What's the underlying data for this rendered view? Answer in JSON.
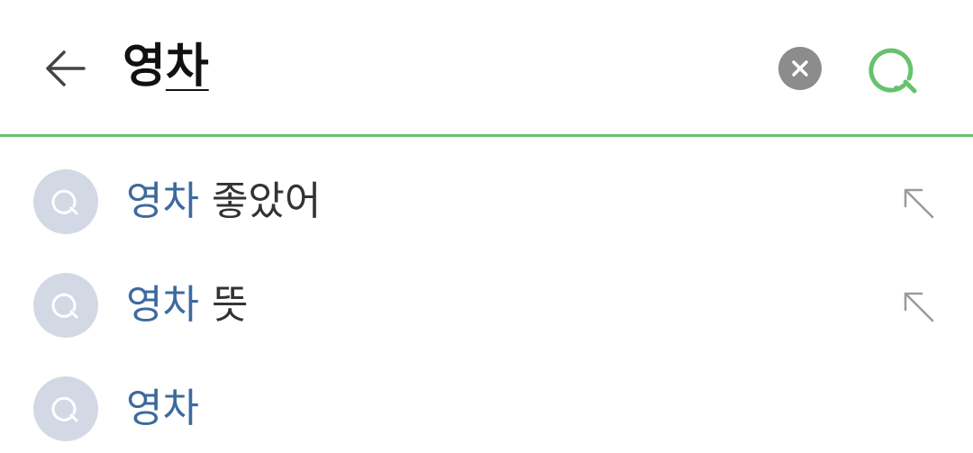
{
  "search": {
    "query_committed": "영",
    "query_composing": "차"
  },
  "suggestions": [
    {
      "highlight": "영차",
      "rest": " 좋았어",
      "has_fill_arrow": true
    },
    {
      "highlight": "영차",
      "rest": " 뜻",
      "has_fill_arrow": true
    },
    {
      "highlight": "영차",
      "rest": "",
      "has_fill_arrow": false
    }
  ],
  "colors": {
    "accent": "#66c26d",
    "highlight_text": "#3d6a9e",
    "suggestion_icon_bg": "#d2d9e5",
    "clear_button_bg": "#8c8c8c"
  },
  "icons": {
    "back": "arrow-left-icon",
    "clear": "close-icon",
    "search": "search-icon",
    "suggestion": "search-icon",
    "fill": "arrow-up-left-icon"
  }
}
